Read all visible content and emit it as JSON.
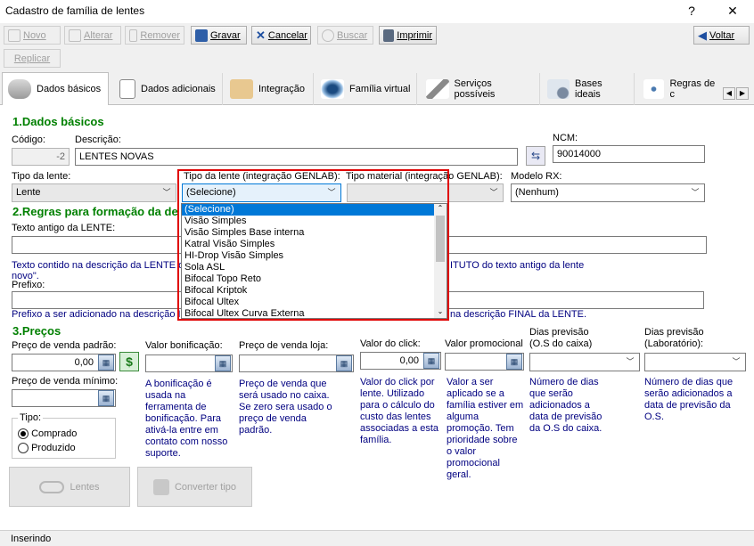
{
  "window": {
    "title": "Cadastro de família de lentes",
    "help": "?",
    "close": "✕"
  },
  "toolbar": {
    "novo": "Novo",
    "alterar": "Alterar",
    "remover": "Remover",
    "gravar": "Gravar",
    "cancelar": "Cancelar",
    "buscar": "Buscar",
    "imprimir": "Imprimir",
    "voltar": "Voltar",
    "replicar": "Replicar"
  },
  "tabs": [
    "Dados básicos",
    "Dados adicionais",
    "Integração",
    "Família virtual",
    "Serviços possíveis",
    "Bases ideais",
    "Regras de c"
  ],
  "dados": {
    "heading": "1.Dados básicos",
    "codigo_label": "Código:",
    "codigo_value": "-2",
    "descricao_label": "Descrição:",
    "descricao_value": "LENTES NOVAS",
    "ncm_label": "NCM:",
    "ncm_value": "90014000",
    "tipo_lente_label": "Tipo da lente:",
    "tipo_lente_value": "Lente",
    "tipo_genlab_label": "Tipo da lente (integração GENLAB):",
    "tipo_genlab_value": "(Selecione)",
    "tipo_material_label": "Tipo material (integração GENLAB):",
    "tipo_material_value": "",
    "modelo_rx_label": "Modelo RX:",
    "modelo_rx_value": "(Nenhum)"
  },
  "dropdown_options": [
    "(Selecione)",
    "Visão Simples",
    "Visão Simples Base interna",
    "Katral Visão Simples",
    "HI-Drop Visão Simples",
    "Sola ASL",
    "Bifocal Topo Reto",
    "Bifocal Kriptok",
    "Bifocal Ultex",
    "Bifocal Ultex Curva Externa"
  ],
  "regras": {
    "heading": "2.Regras para formação da de",
    "texto_antigo_label": "Texto antigo da LENTE:",
    "help1a": "Texto contido na descrição da LENTE q",
    "help1b": "ITUTO do texto antigo da lente",
    "help1c": "novo\".",
    "prefixo_label": "Prefixo:",
    "help2a": "Prefixo a ser adicionado na descrição I",
    "help2b": "na descrição FINAL da LENTE."
  },
  "precos": {
    "heading": "3.Preços",
    "venda_padrao_label": "Preço de venda padrão:",
    "venda_padrao_value": "0,00",
    "venda_minimo_label": "Preço de venda mínimo:",
    "bonificacao_label": "Valor bonificação:",
    "bonificacao_help": "A bonificação é usada na ferramenta de bonificação. Para ativá-la entre em contato com nosso suporte.",
    "venda_loja_label": "Preço de venda loja:",
    "venda_loja_help": "Preço de venda que será usado no caixa. Se zero sera usado o preço de venda padrão.",
    "click_label": "Valor do click:",
    "click_value": "0,00",
    "click_help": "Valor do click por lente. Utilizado para o cálculo do custo das lentes associadas a esta família.",
    "promocional_label": "Valor promocional",
    "promocional_help": "Valor a ser aplicado se a família estiver em alguma promoção. Tem prioridade sobre o valor promocional geral.",
    "dias_caixa_label1": "Dias previsão",
    "dias_caixa_label2": "(O.S do caixa)",
    "dias_caixa_help": "Número de dias que serão adicionados a data de previsão da O.S do caixa.",
    "dias_lab_label1": "Dias previsão",
    "dias_lab_label2": "(Laboratório):",
    "dias_lab_help": "Número de dias que serão adicionados a data de previsão da O.S."
  },
  "tipo": {
    "label": "Tipo:",
    "comprado": "Comprado",
    "produzido": "Produzido"
  },
  "buttons": {
    "lentes": "Lentes",
    "converter": "Converter tipo"
  },
  "status": {
    "text": "Inserindo"
  },
  "colors": {
    "section": "#008000",
    "help": "#000080",
    "highlight": "#e00000",
    "selected": "#0078d7"
  }
}
